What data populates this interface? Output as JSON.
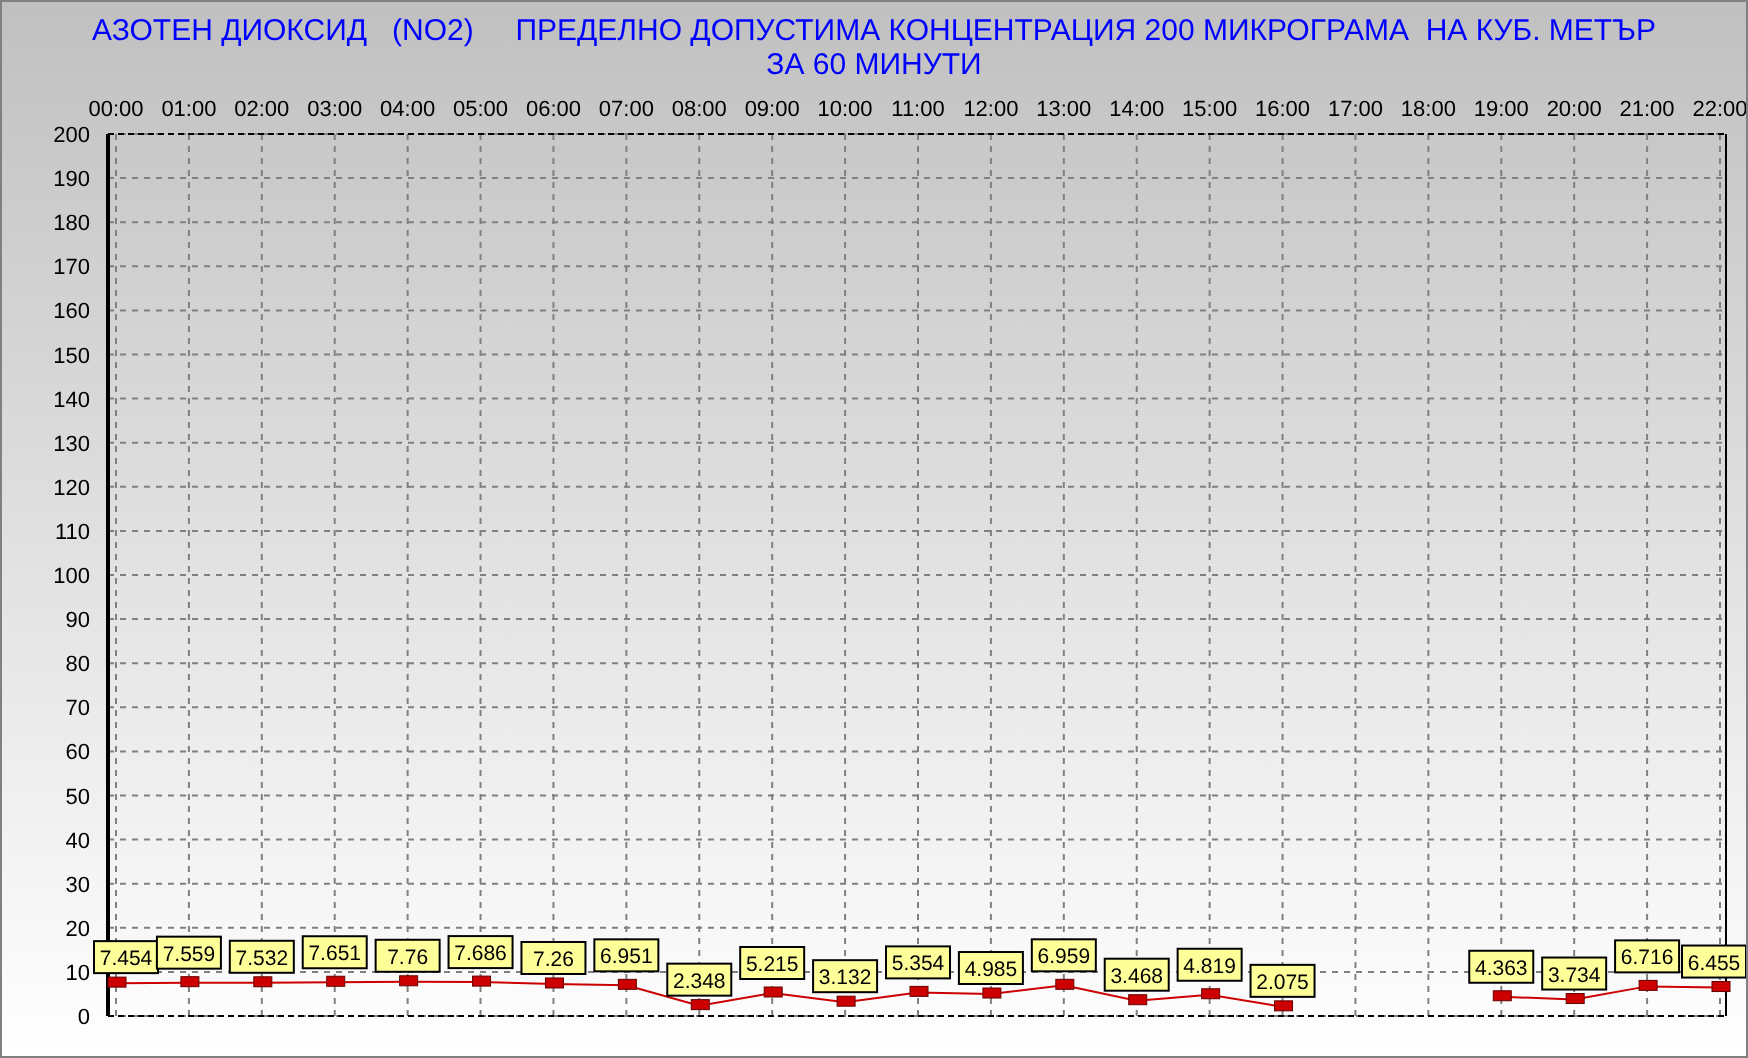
{
  "chart": {
    "title": "АЗОТЕН ДИОКСИД   (NO2)     ПРЕДЕЛНО ДОПУСТИМА КОНЦЕНТРАЦИЯ 200 МИКРОГРАМА  НА КУБ. МЕТЪР ЗА 60 МИНУТИ",
    "chart_data": {
      "type": "line",
      "grid": true,
      "categories": [
        "00:00",
        "01:00",
        "02:00",
        "03:00",
        "04:00",
        "05:00",
        "06:00",
        "07:00",
        "08:00",
        "09:00",
        "10:00",
        "11:00",
        "12:00",
        "13:00",
        "14:00",
        "15:00",
        "16:00",
        "17:00",
        "18:00",
        "19:00",
        "20:00",
        "21:00",
        "22:00"
      ],
      "series": [
        {
          "color": "#cc0000",
          "marker": "square",
          "values": [
            7.454,
            7.559,
            7.532,
            7.651,
            7.76,
            7.686,
            7.26,
            6.951,
            2.348,
            5.215,
            3.132,
            5.354,
            4.985,
            6.959,
            3.468,
            4.819,
            2.075,
            null,
            null,
            4.363,
            3.734,
            6.716,
            6.455
          ]
        }
      ],
      "value_labels": [
        "7.454",
        "7.559",
        "7.532",
        "7.651",
        "7.76",
        "7.686",
        "7.26",
        "6.951",
        "2.348",
        "5.215",
        "3.132",
        "5.354",
        "4.985",
        "6.959",
        "3.468",
        "4.819",
        "2.075",
        null,
        null,
        "4.363",
        "3.734",
        "6.716",
        "6.455"
      ],
      "ylim": [
        0,
        200
      ],
      "yticks": [
        0,
        10,
        20,
        30,
        40,
        50,
        60,
        70,
        80,
        90,
        100,
        110,
        120,
        130,
        140,
        150,
        160,
        170,
        180,
        190,
        200
      ]
    }
  }
}
